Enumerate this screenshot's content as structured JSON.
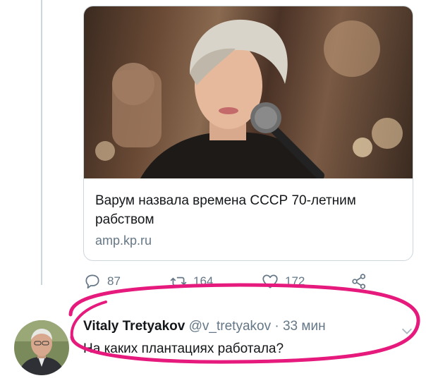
{
  "card": {
    "image_icon": "singer-with-microphone-photo",
    "title": "Варум назвала времена СССР 70-летним рабством",
    "domain": "amp.kp.ru"
  },
  "actions": {
    "reply_icon": "reply-icon",
    "reply_count": "87",
    "retweet_icon": "retweet-icon",
    "retweet_count": "164",
    "like_icon": "heart-icon",
    "like_count": "172",
    "share_icon": "share-icon"
  },
  "reply": {
    "name": "Vitaly Tretyakov",
    "handle": "@v_tretyakov",
    "separator": "·",
    "time": "33 мин",
    "text": "На каких плантациях работала?",
    "menu_icon": "chevron-down-icon"
  },
  "colors": {
    "text": "#14171a",
    "secondary": "#657786",
    "border": "#ccd6dd",
    "highlight": "#e6197d"
  }
}
